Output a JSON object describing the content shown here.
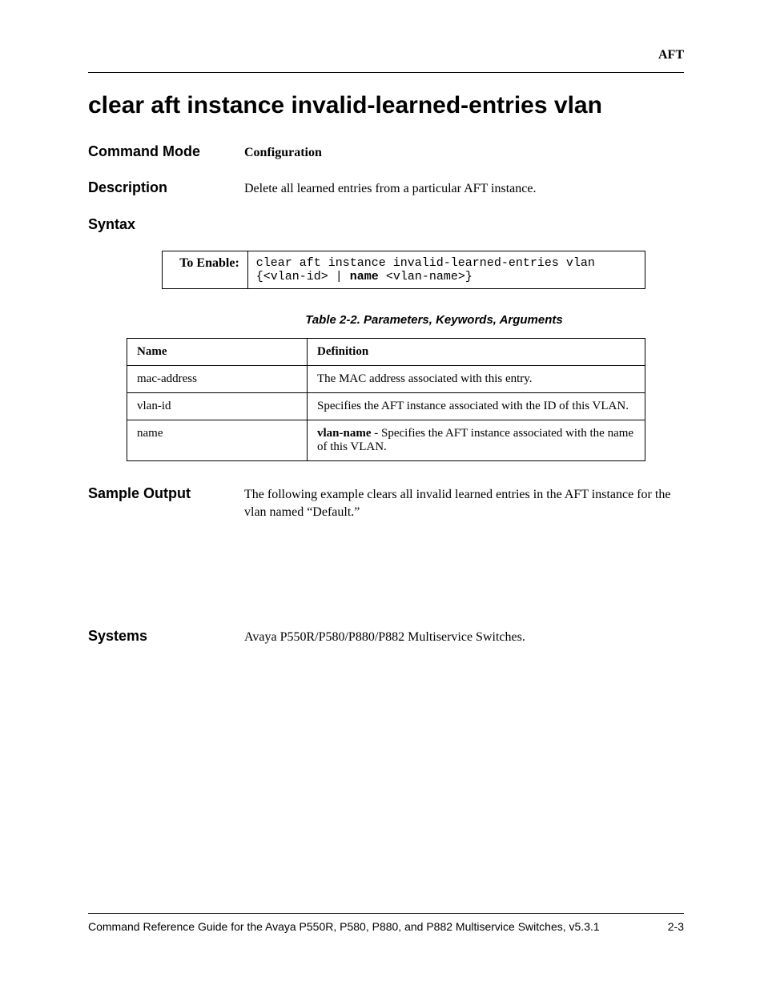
{
  "header": {
    "section": "AFT"
  },
  "title": "clear aft instance invalid-learned-entries vlan",
  "command_mode": {
    "label": "Command Mode",
    "value": "Configuration"
  },
  "description": {
    "label": "Description",
    "value": "Delete all learned entries from a particular AFT instance."
  },
  "syntax": {
    "label": "Syntax",
    "to_enable_label": "To Enable:",
    "line1_a": "clear aft instance invalid-learned-entries vlan",
    "line2_a": "{<vlan-id> | ",
    "line2_kw": "name",
    "line2_b": " <vlan-name>}"
  },
  "table": {
    "caption": "Table 2-2.  Parameters, Keywords, Arguments",
    "headers": {
      "name": "Name",
      "definition": "Definition"
    },
    "rows": [
      {
        "name": "mac-address",
        "def_bold": "",
        "def": "The MAC address associated with this entry."
      },
      {
        "name": "vlan-id",
        "def_bold": "",
        "def": "Specifies the AFT instance associated with the ID of this VLAN."
      },
      {
        "name": "name",
        "def_bold": "vlan-name",
        "def": " - Specifies the AFT instance associated with the name of this VLAN."
      }
    ]
  },
  "sample_output": {
    "label": "Sample Output",
    "value": "The following example clears all invalid learned entries in the AFT instance for the vlan named “Default.”"
  },
  "systems": {
    "label": "Systems",
    "value": "Avaya P550R/P580/P880/P882 Multiservice Switches."
  },
  "footer": {
    "text": "Command Reference Guide for the Avaya P550R, P580, P880, and P882 Multiservice Switches, v5.3.1",
    "page": "2-3"
  }
}
